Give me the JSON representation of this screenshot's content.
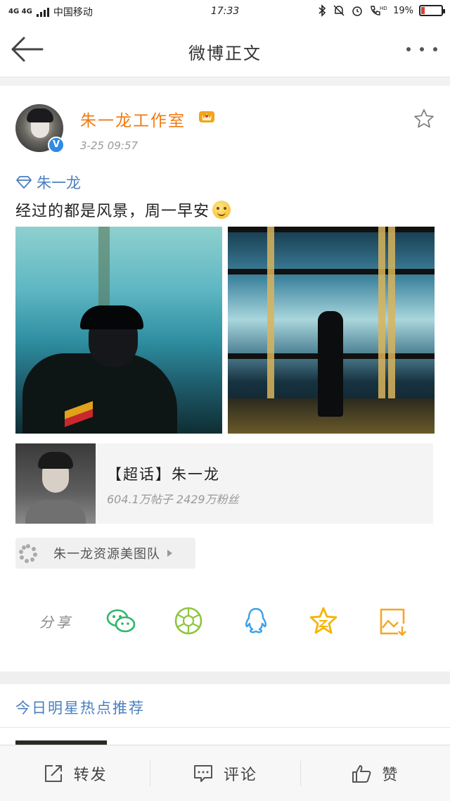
{
  "status_bar": {
    "network": "4G 4G",
    "carrier": "中国移动",
    "time": "17:33",
    "battery_percent": "19%",
    "battery_level": 0.19
  },
  "nav": {
    "title": "微博正文",
    "back_icon": "arrow-left-icon",
    "more_icon": "more-dots-icon"
  },
  "post": {
    "author": "朱一龙工作室",
    "time": "3-25 09:57",
    "topic": "朱一龙",
    "text": "经过的都是风景，周一早安",
    "author_color": "#f07a12",
    "link_color": "#4a7fc0"
  },
  "topic_card": {
    "title": "【超话】朱一龙",
    "meta": "604.1万帖子 2429万粉丝"
  },
  "source_chip": {
    "label": "朱一龙资源美图队"
  },
  "share": {
    "label": "分享",
    "buttons": [
      "wechat-icon",
      "moments-icon",
      "qq-icon",
      "favorite-star-icon",
      "save-image-icon"
    ]
  },
  "recommend": {
    "title": "今日明星热点推荐"
  },
  "bottom_bar": {
    "repost": "转发",
    "comment": "评论",
    "like": "赞"
  }
}
